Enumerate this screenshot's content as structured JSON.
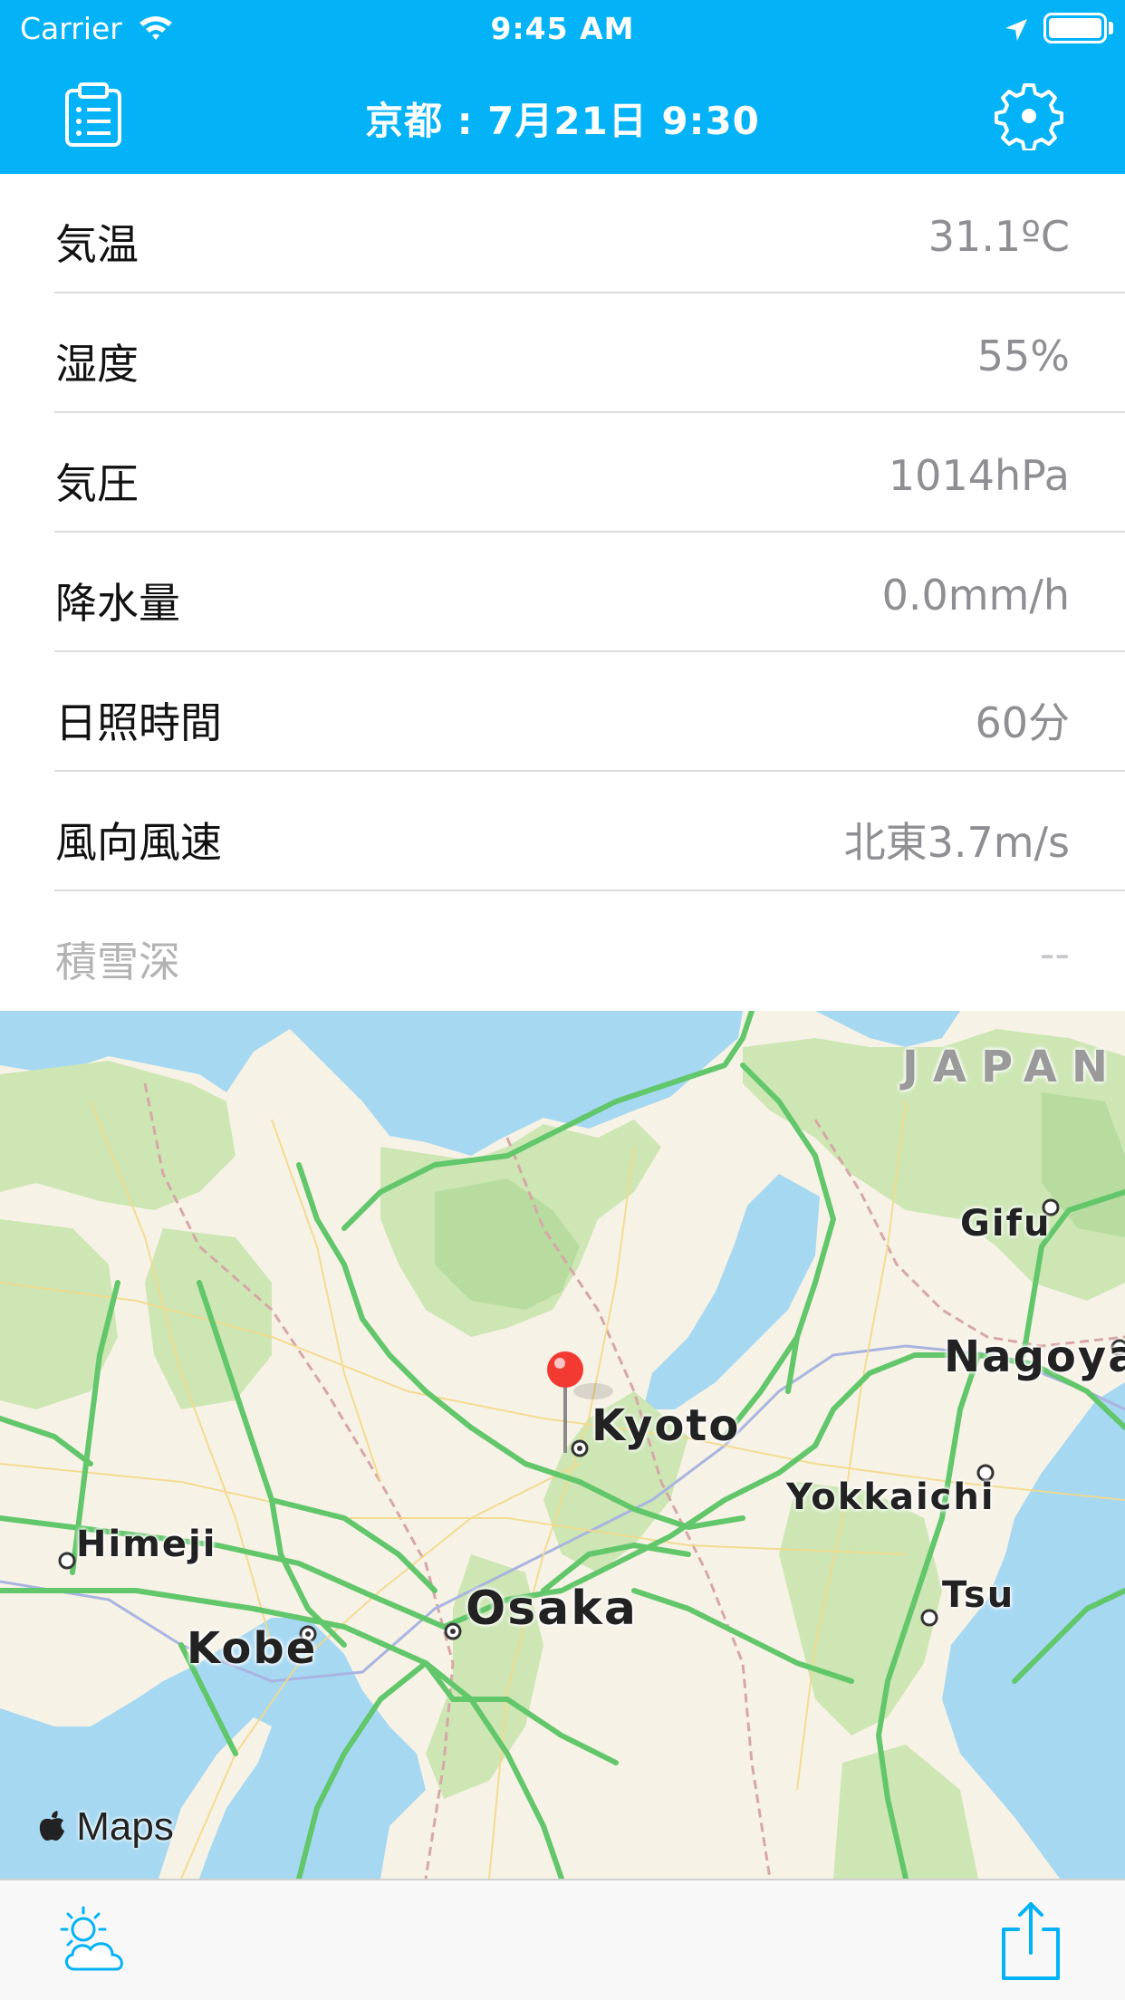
{
  "status_bar": {
    "carrier": "Carrier",
    "time": "9:45 AM"
  },
  "nav": {
    "title": "京都 : 7月21日 9:30",
    "left_icon": "clipboard-list-icon",
    "right_icon": "gear-icon"
  },
  "weather_rows": [
    {
      "label": "気温",
      "value": "31.1ºC",
      "enabled": true
    },
    {
      "label": "湿度",
      "value": "55%",
      "enabled": true
    },
    {
      "label": "気圧",
      "value": "1014hPa",
      "enabled": true
    },
    {
      "label": "降水量",
      "value": "0.0mm/h",
      "enabled": true
    },
    {
      "label": "日照時間",
      "value": "60分",
      "enabled": true
    },
    {
      "label": "風向風速",
      "value": "北東3.7m/s",
      "enabled": true
    },
    {
      "label": "積雪深",
      "value": "--",
      "enabled": false
    }
  ],
  "map": {
    "country_label": "JAPAN",
    "places": {
      "kyoto": "Kyoto",
      "osaka": "Osaka",
      "kobe": "Kobe",
      "himeji": "Himeji",
      "gifu": "Gifu",
      "nagoya": "Nagoya",
      "yokkaichi": "Yokkaichi",
      "tsu": "Tsu"
    },
    "attribution": "Maps"
  },
  "toolbar": {
    "left_icon": "weather-sun-cloud-icon",
    "right_icon": "share-icon"
  },
  "colors": {
    "accent": "#03b2f7",
    "water": "#a6d8f2",
    "land": "#f7f2e6",
    "green_area": "#cde6b4",
    "highway": "#62c66b",
    "pin": "#f33a32"
  }
}
